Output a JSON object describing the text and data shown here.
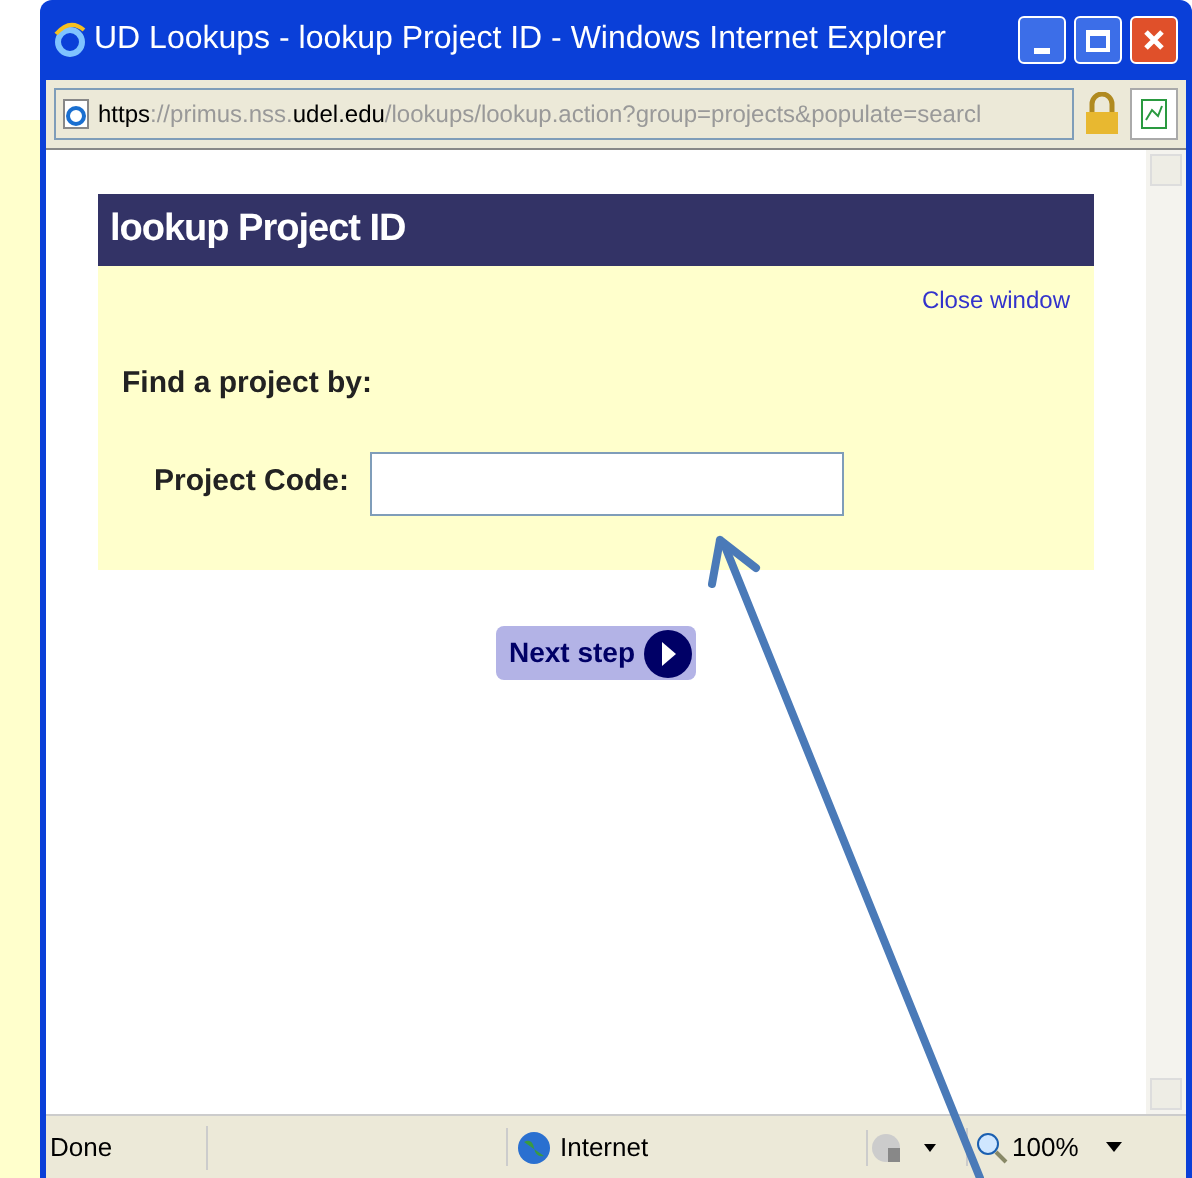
{
  "window": {
    "title": "UD Lookups - lookup Project ID - Windows Internet Explorer"
  },
  "address_bar": {
    "segments": [
      {
        "text": "https",
        "emphasis": true
      },
      {
        "text": "://primus.nss.",
        "emphasis": false
      },
      {
        "text": "udel.edu",
        "emphasis": true
      },
      {
        "text": "/lookups/lookup.action?group=projects&populate=searcl",
        "emphasis": false
      }
    ]
  },
  "panel": {
    "title": "lookup Project ID",
    "close_link": "Close window",
    "heading": "Find a project by:",
    "field_label": "Project Code:",
    "button": "Next step"
  },
  "status_bar": {
    "status": "Done",
    "zone": "Internet",
    "zoom": "100%"
  }
}
